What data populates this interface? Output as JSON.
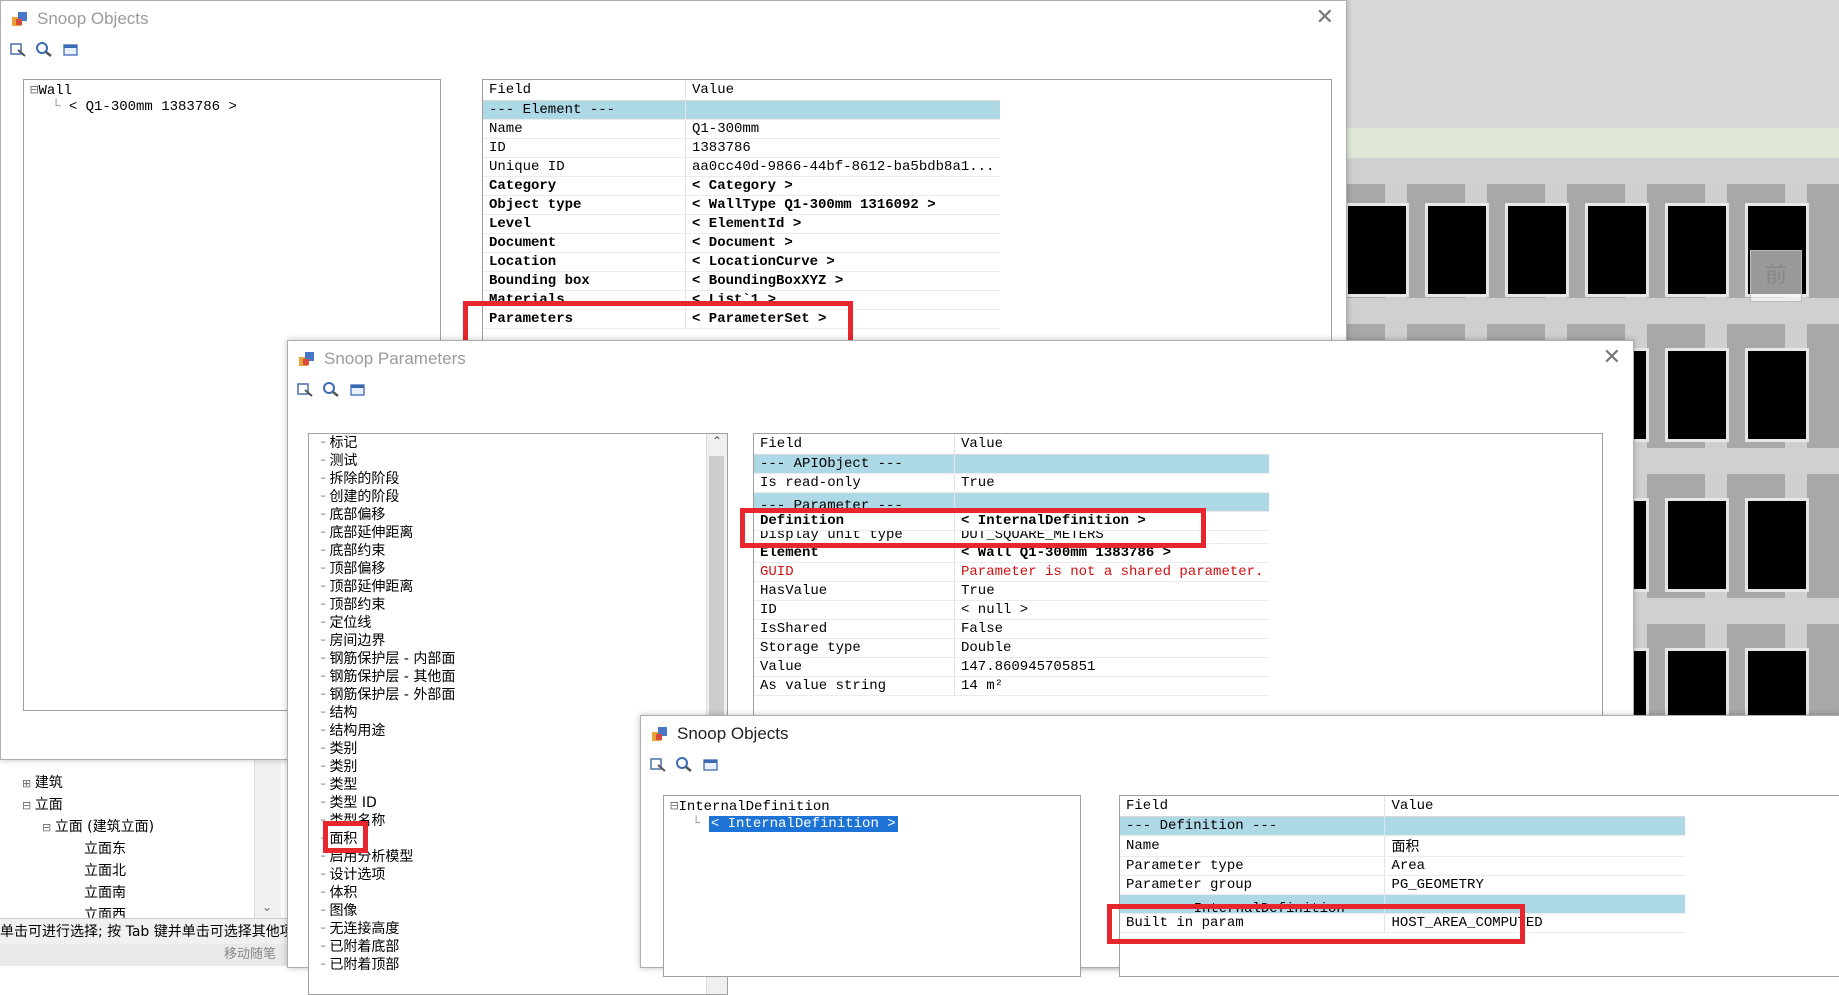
{
  "viewport": {
    "view_cube_label": "前"
  },
  "windows": {
    "snoop_objects_1": {
      "title": "Snoop Objects",
      "tree": {
        "root": "Wall",
        "child": "< Q1-300mm  1383786 >"
      },
      "grid": {
        "header": [
          "Field",
          "Value"
        ],
        "section": "--- Element ---",
        "rows": [
          {
            "field": "Name",
            "value": "Q1-300mm"
          },
          {
            "field": "ID",
            "value": "1383786"
          },
          {
            "field": "Unique ID",
            "value": "aa0cc40d-9866-44bf-8612-ba5bdb8a1..."
          },
          {
            "field": "Category",
            "value": "< Category >"
          },
          {
            "field": "Object type",
            "value": "< WallType  Q1-300mm  1316092 >"
          },
          {
            "field": "Level",
            "value": "< ElementId >"
          },
          {
            "field": "Document",
            "value": "< Document >"
          },
          {
            "field": "Location",
            "value": "< LocationCurve >"
          },
          {
            "field": "Bounding box",
            "value": "< BoundingBoxXYZ >"
          },
          {
            "field": "Materials",
            "value": "< List`1 >"
          },
          {
            "field": "Parameters",
            "value": "< ParameterSet >"
          }
        ]
      }
    },
    "snoop_parameters": {
      "title": "Snoop Parameters",
      "list": [
        "标记",
        "测试",
        "拆除的阶段",
        "创建的阶段",
        "底部偏移",
        "底部延伸距离",
        "底部约束",
        "顶部偏移",
        "顶部延伸距离",
        "顶部约束",
        "定位线",
        "房间边界",
        "钢筋保护层 - 内部面",
        "钢筋保护层 - 其他面",
        "钢筋保护层 - 外部面",
        "结构",
        "结构用途",
        "类别",
        "类别",
        "类型",
        "类型 ID",
        "类型名称",
        "面积",
        "启用分析模型",
        "设计选项",
        "体积",
        "图像",
        "无连接高度",
        "已附着底部",
        "已附着顶部"
      ],
      "grid": {
        "header": [
          "Field",
          "Value"
        ],
        "section1": "--- APIObject ---",
        "row_readonly": {
          "field": "Is read-only",
          "value": "True"
        },
        "section2": "--- Parameter ---",
        "rows": [
          {
            "field": "Definition",
            "value": "< InternalDefinition >"
          },
          {
            "field": "Display unit type",
            "value": "DUT_SQUARE_METERS"
          },
          {
            "field": "Element",
            "value": "< Wall  Q1-300mm  1383786 >"
          },
          {
            "field": "GUID",
            "value": "Parameter is not a shared parameter."
          },
          {
            "field": "HasValue",
            "value": "True"
          },
          {
            "field": "ID",
            "value": "< null >"
          },
          {
            "field": "IsShared",
            "value": "False"
          },
          {
            "field": "Storage type",
            "value": "Double"
          },
          {
            "field": "Value",
            "value": "147.860945705851"
          },
          {
            "field": "As value string",
            "value": "14 m²"
          }
        ]
      }
    },
    "snoop_objects_2": {
      "title": "Snoop Objects",
      "tree": {
        "root": "InternalDefinition",
        "child": "< InternalDefinition >"
      },
      "grid": {
        "header": [
          "Field",
          "Value"
        ],
        "section1": "--- Definition ---",
        "rows": [
          {
            "field": "Name",
            "value": "面积"
          },
          {
            "field": "Parameter type",
            "value": "Area"
          },
          {
            "field": "Parameter group",
            "value": "PG_GEOMETRY"
          }
        ],
        "section2": "--- InternalDefinition ---",
        "row_builtin": {
          "field": "Built in param",
          "value": "HOST_AREA_COMPUTED"
        }
      }
    }
  },
  "project_browser": {
    "items": [
      "建筑",
      "立面",
      "立面 (建筑立面)",
      "立面东",
      "立面北",
      "立面南",
      "立面西"
    ]
  },
  "status_bar": {
    "text": "单击可进行选择; 按 Tab 键并单击可选择其他项目",
    "sub": "移动随笔"
  }
}
